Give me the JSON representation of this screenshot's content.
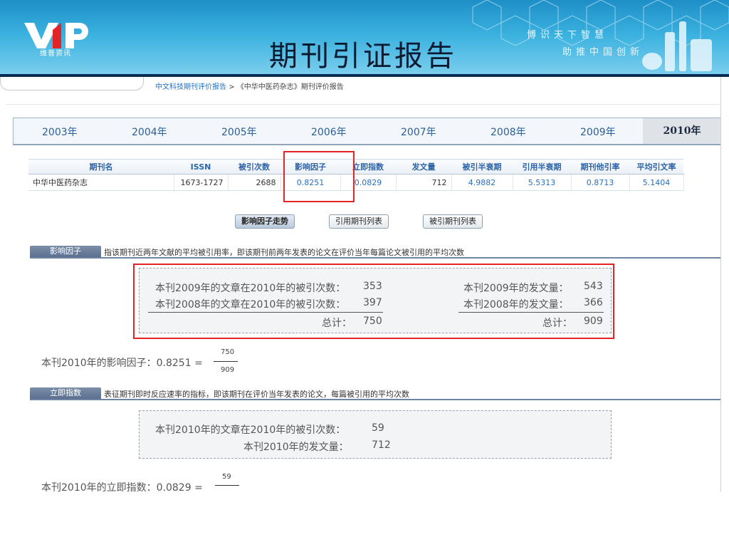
{
  "banner": {
    "title": "期刊引证报告",
    "logo_text": "维普资讯",
    "slogan_line1": "博识天下智慧",
    "slogan_line2": "助推中国创新",
    "brand_color": "#2aa3d6"
  },
  "breadcrumb": {
    "link": "中文科技期刊评价报告",
    "separator": ">",
    "current": "《中华中医药杂志》期刊评价报告"
  },
  "years": [
    "2003年",
    "2004年",
    "2005年",
    "2006年",
    "2007年",
    "2008年",
    "2009年",
    "2010年"
  ],
  "active_year": "2010年",
  "table": {
    "headers": [
      "期刊名",
      "ISSN",
      "被引次数",
      "影响因子",
      "立即指数",
      "发文量",
      "被引半衰期",
      "引用半衰期",
      "期刊他引率",
      "平均引文率"
    ],
    "row": [
      "中华中医药杂志",
      "1673-1727",
      "2688",
      "0.8251",
      "0.0829",
      "712",
      "4.9882",
      "5.5313",
      "0.8713",
      "5.1404"
    ]
  },
  "buttons": {
    "impact_trend": "影响因子走势",
    "citing_list": "引用期刊列表",
    "cited_list": "被引期刊列表"
  },
  "impact": {
    "tab": "影响因子",
    "desc": "指该期刊近两年文献的平均被引用率，即该期刊前两年发表的论文在评价当年每篇论文被引用的平均次数",
    "l1_label": "本刊2009年的文章在2010年的被引次数：",
    "l1_value": "353",
    "l2_label": "本刊2008年的文章在2010年的被引次数：",
    "l2_value": "397",
    "l_total_label": "总计：",
    "l_total_value": "750",
    "r1_label": "本刊2009年的发文量：",
    "r1_value": "543",
    "r2_label": "本刊2008年的发文量：",
    "r2_value": "366",
    "r_total_label": "总计：",
    "r_total_value": "909",
    "formula": "本刊2010年的影响因子：0.8251 =",
    "numerator": "750",
    "denominator": "909"
  },
  "immediacy": {
    "tab": "立即指数",
    "desc": "表征期刊即时反应速率的指标，即该期刊在评价当年发表的论文，每篇被引用的平均次数",
    "l1_label": "本刊2010年的文章在2010年的被引次数：",
    "l1_value": "59",
    "l2_label": "本刊2010年的发文量：",
    "l2_value": "712",
    "formula": "本刊2010年的立即指数：0.0829 =",
    "numerator": "59"
  }
}
